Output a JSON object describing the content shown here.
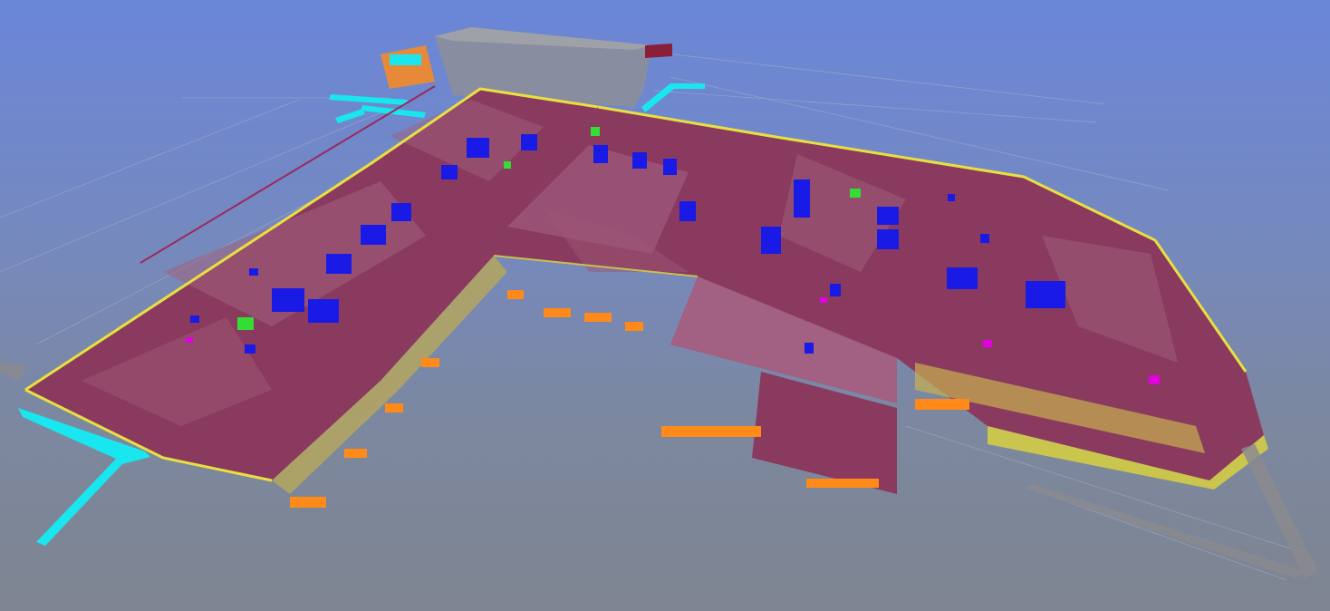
{
  "viewport": {
    "kind": "3D BIM model viewer",
    "background_top": "#6a86d8",
    "background_bottom": "#7e8490"
  },
  "colors": {
    "roof": "#8a3a5e",
    "roof_light": "#a0607e",
    "wall_outline": "#d8d040",
    "structure": "#b8a85a",
    "footing": "#ff8a1a",
    "equipment": "#1a1ae6",
    "equipment_green": "#33dd33",
    "duct_cyan": "#19e6ee",
    "magenta": "#e000e0",
    "ghost": "#8a8a90"
  },
  "model": {
    "equipment_icon": "hvac-unit-icon",
    "green_unit_icon": "exhaust-fan-icon",
    "duct_icon": "duct-run-icon"
  }
}
